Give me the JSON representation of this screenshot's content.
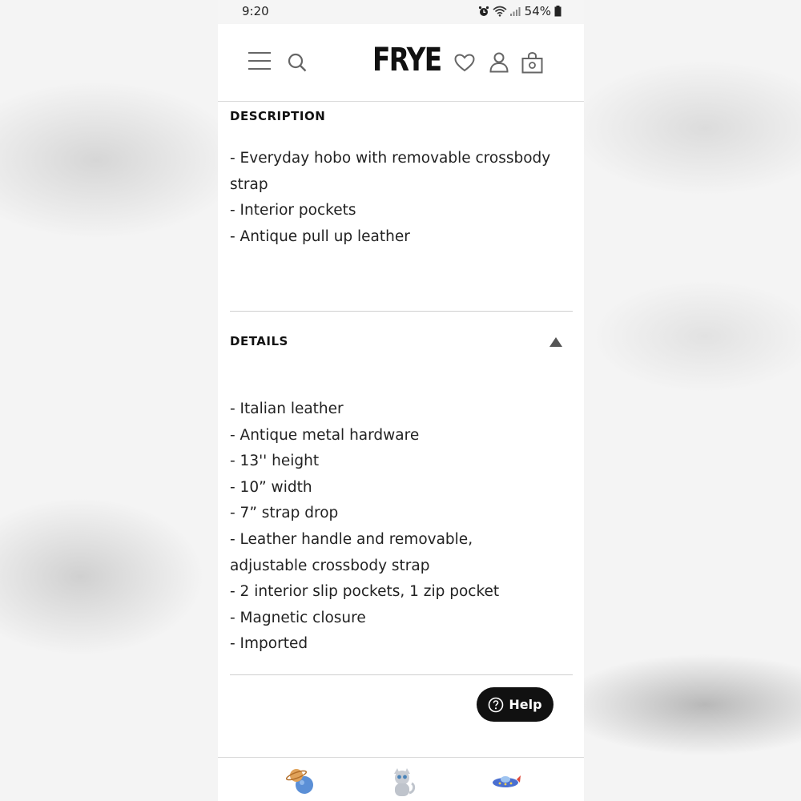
{
  "status": {
    "time": "9:20",
    "battery": "54%"
  },
  "brand": {
    "logo": "FRYE"
  },
  "description": {
    "title": "DESCRIPTION",
    "lines": [
      "- Everyday hobo with removable crossbody",
      "strap",
      "- Interior pockets",
      "- Antique pull up leather"
    ]
  },
  "details": {
    "title": "DETAILS",
    "lines": [
      "- Italian leather",
      "- Antique metal hardware",
      "- 13'' height",
      "- 10” width",
      "- 7” strap drop",
      "- Leather handle and removable,",
      "adjustable crossbody strap",
      "- 2 interior slip pockets, 1 zip pocket",
      "- Magnetic closure",
      "- Imported"
    ]
  },
  "help": {
    "label": "Help"
  },
  "icons": {
    "header": [
      "menu-icon",
      "search-icon",
      "heart-icon",
      "account-icon",
      "bag-icon"
    ],
    "bottom": [
      "planet-sticker-icon",
      "cat-sticker-icon",
      "spaceship-sticker-icon"
    ]
  },
  "colors": {
    "accent": "#111111",
    "background": "#ffffff",
    "divider": "#cfcfcf"
  }
}
